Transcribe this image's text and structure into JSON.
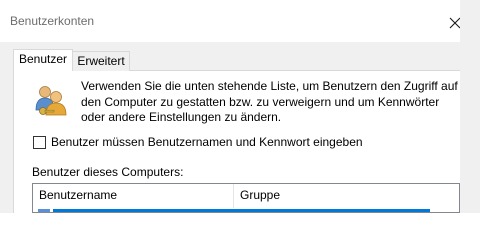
{
  "window": {
    "title": "Benutzerkonten",
    "close_icon": "close-icon"
  },
  "tabs": [
    {
      "label": "Benutzer",
      "active": true
    },
    {
      "label": "Erweitert",
      "active": false
    }
  ],
  "users_tab": {
    "icon": "users-icon",
    "intro_text": "Verwenden Sie die unten stehende Liste, um Benutzern den Zugriff auf den Computer zu gestatten bzw. zu verweigern und um Kennwörter oder andere Einstellungen zu ändern.",
    "checkbox_label": "Benutzer müssen Benutzernamen und Kennwort eingeben",
    "checkbox_checked": false,
    "list_label": "Benutzer dieses Computers:",
    "columns": [
      "Benutzername",
      "Gruppe"
    ]
  },
  "colors": {
    "selection": "#0078d7",
    "panel_bg": "#f0f0f0",
    "title_text": "#6d6d6d"
  }
}
